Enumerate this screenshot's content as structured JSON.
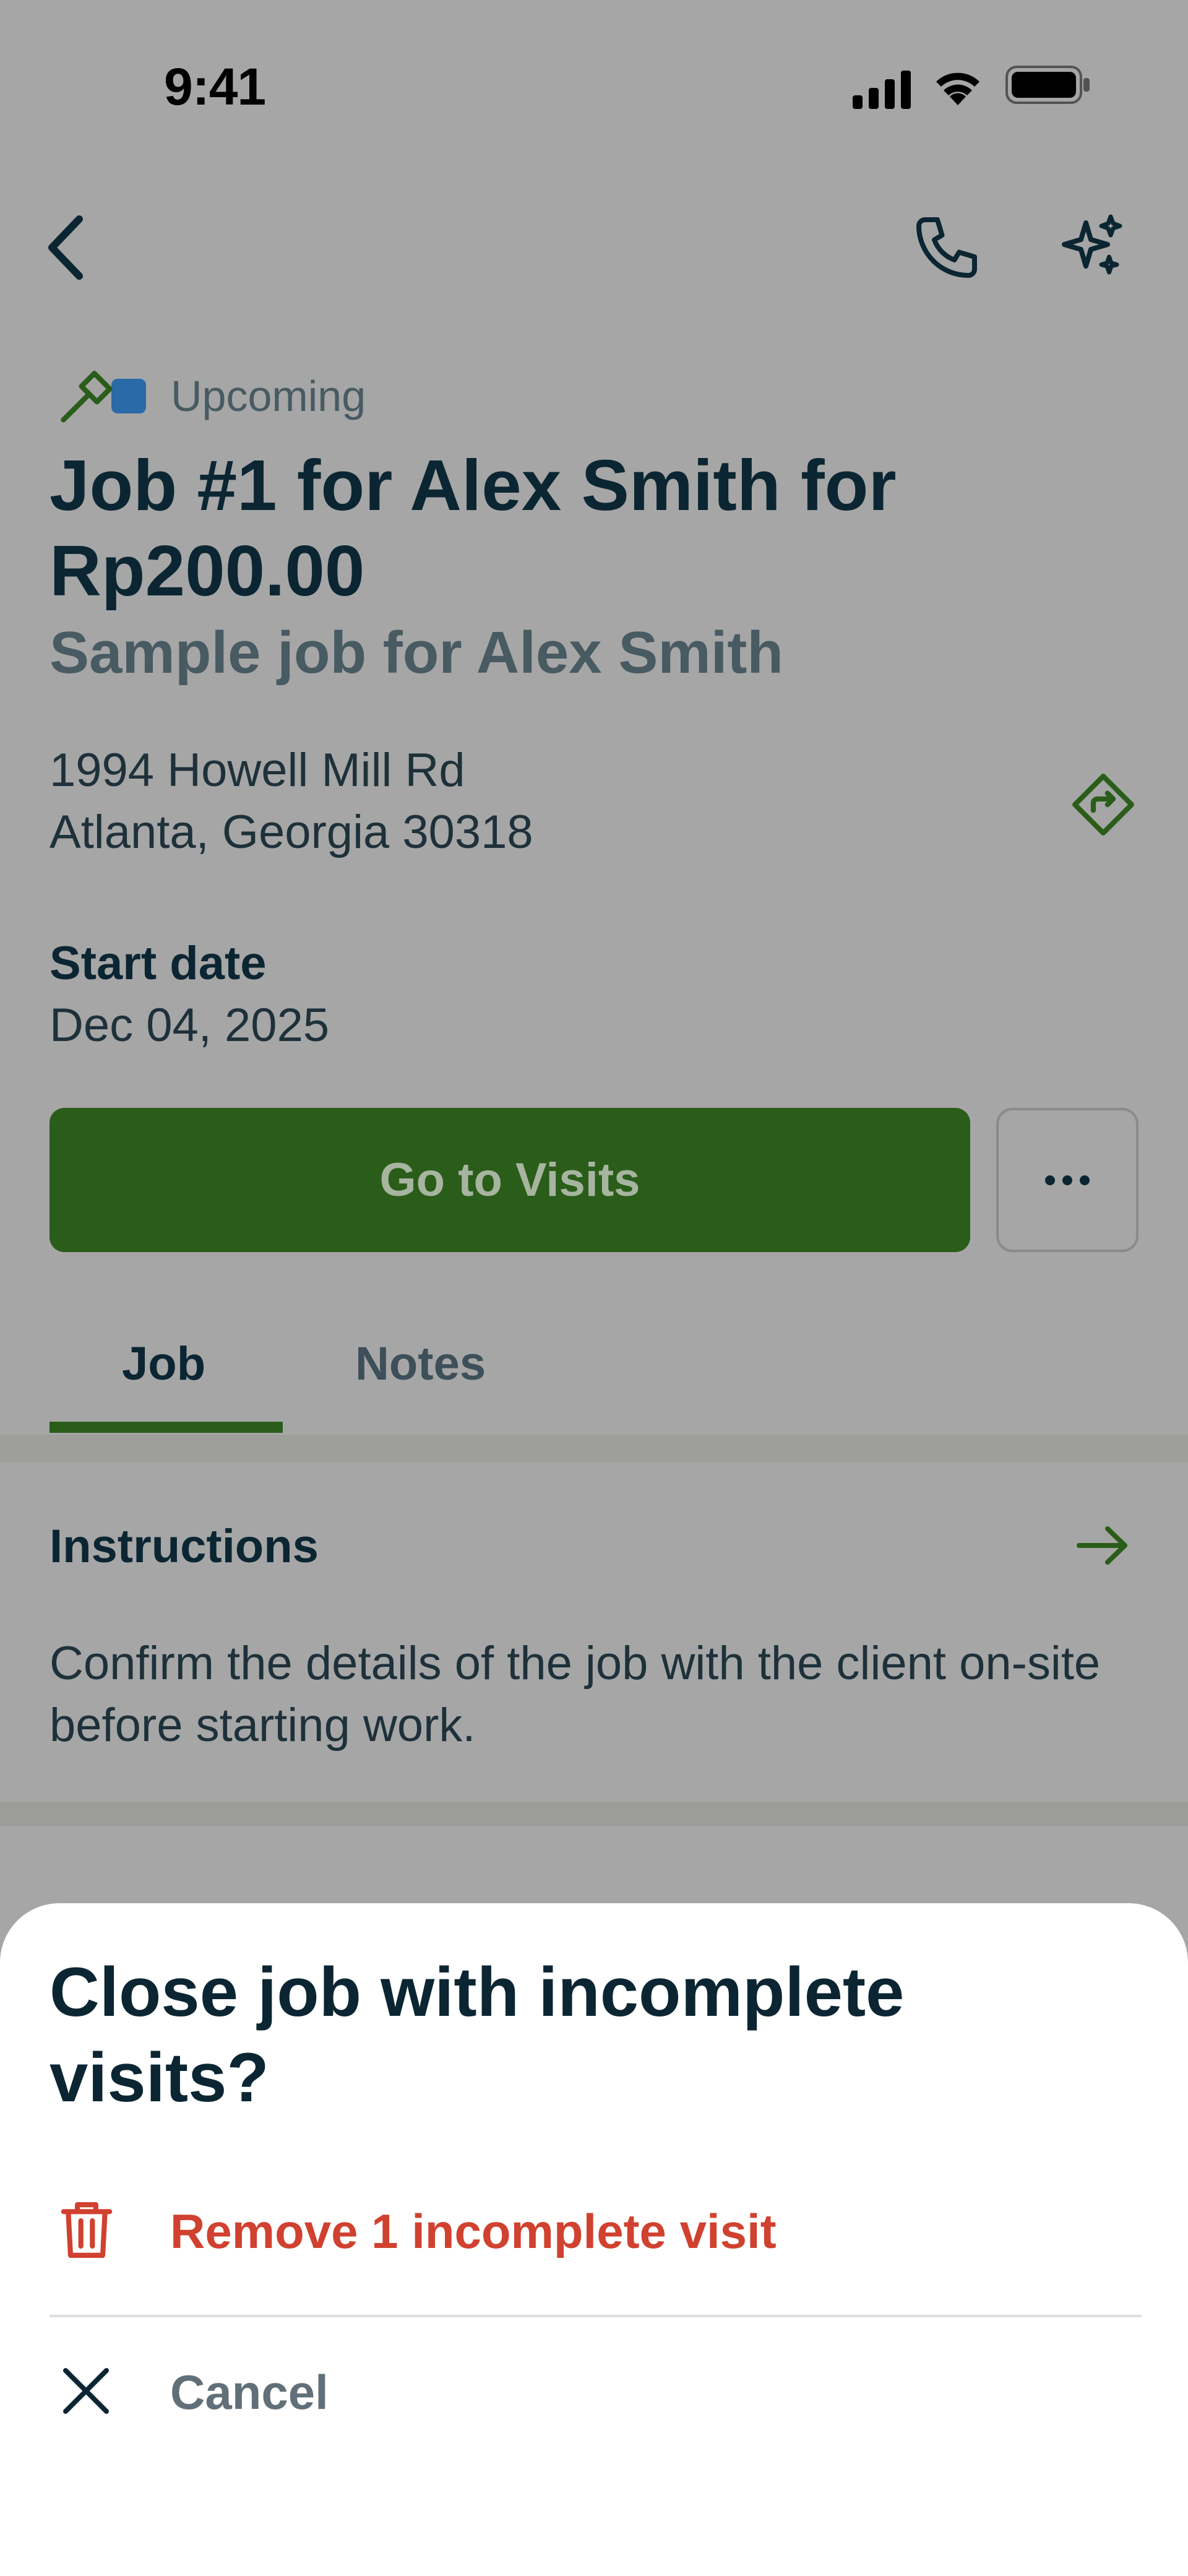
{
  "status_bar": {
    "time": "9:41"
  },
  "header": {
    "icons": [
      "back-arrow-icon",
      "phone-icon",
      "sparkles-icon"
    ]
  },
  "job": {
    "status": "Upcoming",
    "status_color": "#2a6aa8",
    "title": "Job #1 for Alex Smith for Rp200.00",
    "subtitle": "Sample job for Alex Smith",
    "address_line1": "1994 Howell Mill Rd",
    "address_line2": "Atlanta, Georgia 30318",
    "start_date_label": "Start date",
    "start_date_value": "Dec 04, 2025",
    "primary_button": "Go to Visits"
  },
  "tabs": {
    "job": "Job",
    "notes": "Notes"
  },
  "instructions": {
    "title": "Instructions",
    "body": "Confirm the details of the job with the client on-site before starting work."
  },
  "sheet": {
    "title": "Close job with incomplete visits?",
    "remove_label": "Remove 1 incomplete visit",
    "cancel_label": "Cancel"
  },
  "colors": {
    "brand_green": "#2a5d1a",
    "destructive_red": "#d0412f",
    "overlay": "#a6a6a6"
  }
}
